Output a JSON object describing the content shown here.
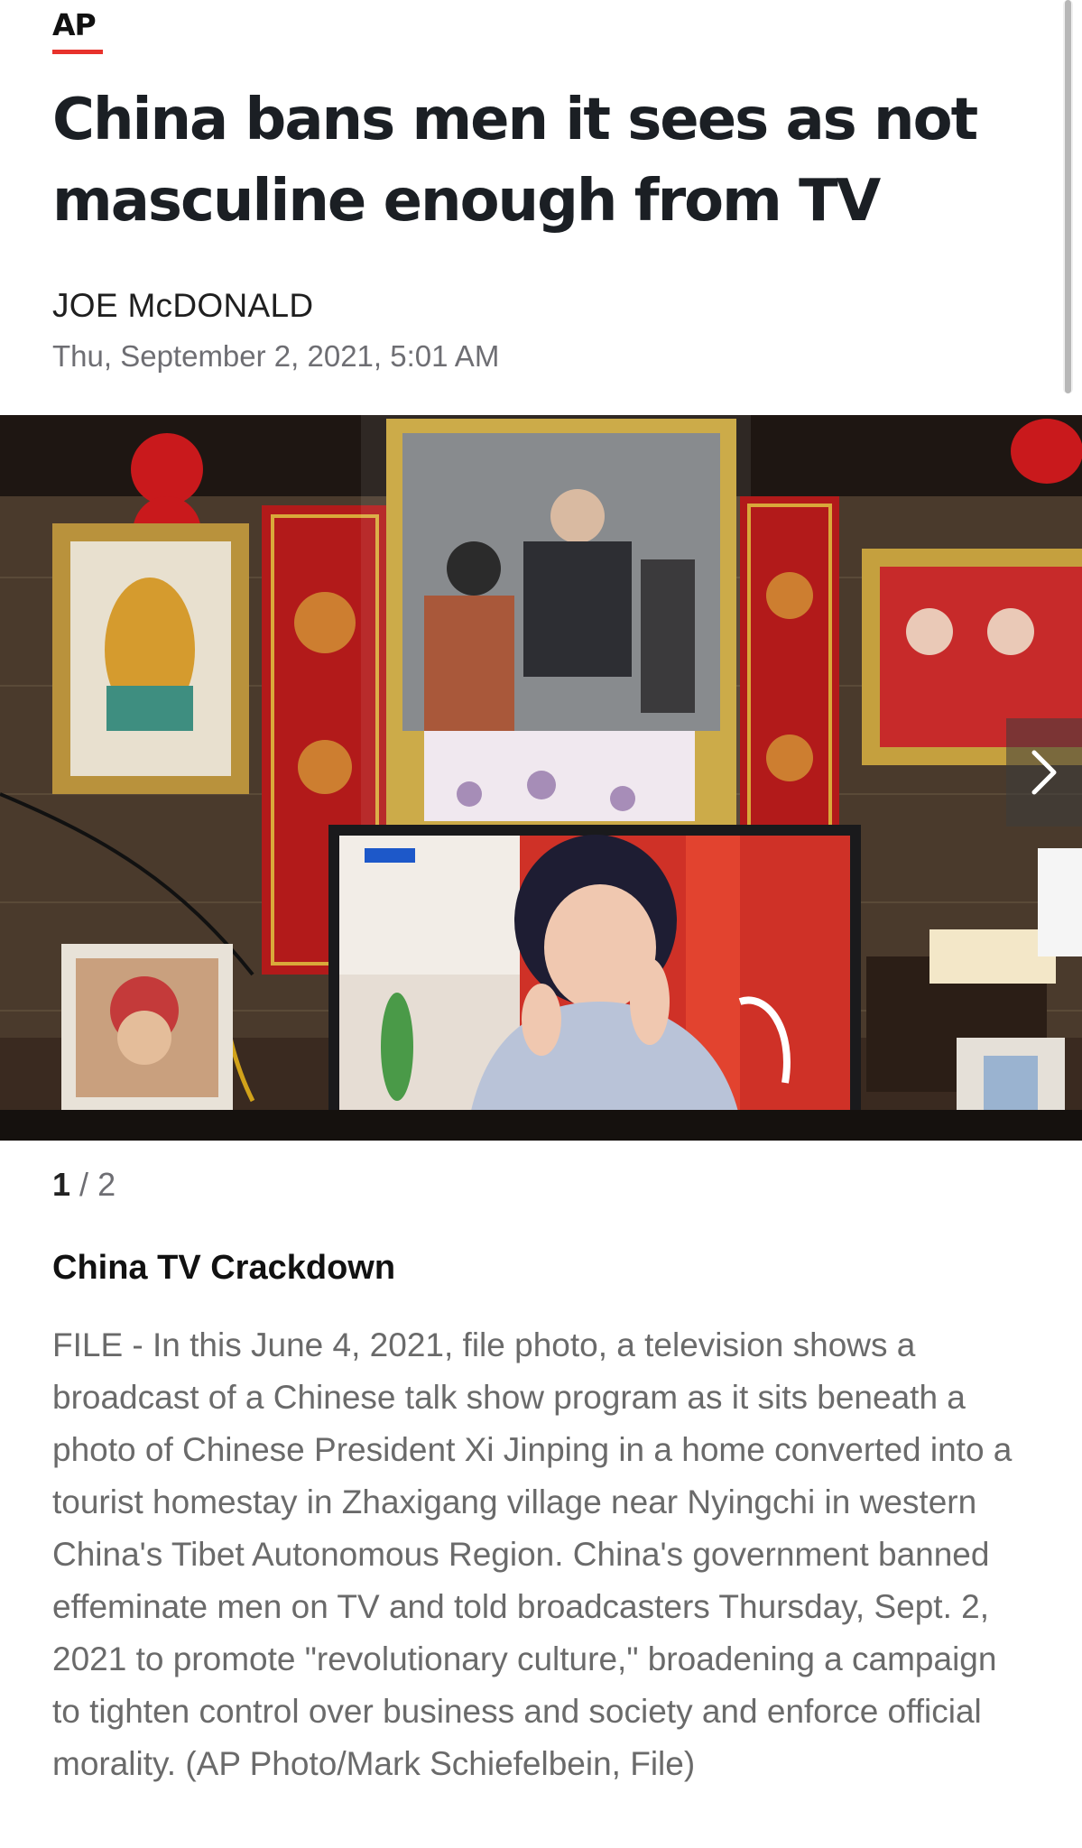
{
  "source": {
    "logo_text": "AP",
    "accent_color": "#e8322c"
  },
  "article": {
    "headline": "China bans men it sees as not masculine enough from TV",
    "author": "JOE McDONALD",
    "timestamp": "Thu, September 2, 2021, 5:01 AM"
  },
  "gallery": {
    "current": "1",
    "separator": "/",
    "total": "2",
    "next_icon": "chevron-right-icon",
    "caption_title": "China TV Crackdown",
    "caption_body": "FILE - In this June 4, 2021, file photo, a television shows a broadcast of a Chinese talk show program as it sits beneath a photo of Chinese President Xi Jinping in a home converted into a tourist homestay in Zhaxigang village near Nyingchi in western China's Tibet Autonomous Region. China's government banned effeminate men on TV and told broadcasters Thursday, Sept. 2, 2021 to promote \"revolutionary culture,\" broadening a campaign to tighten control over business and society and enforce official morality. (AP Photo/Mark Schiefelbein, File)"
  }
}
